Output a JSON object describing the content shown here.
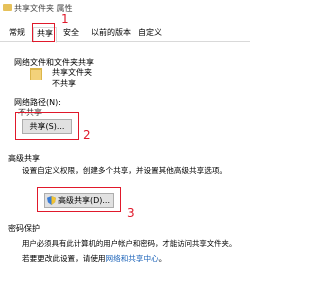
{
  "window": {
    "title": "共享文件夹 属性"
  },
  "tabs": [
    {
      "label": "常规"
    },
    {
      "label": "共享"
    },
    {
      "label": "安全"
    },
    {
      "label": "以前的版本"
    },
    {
      "label": "自定义"
    }
  ],
  "network_share": {
    "section_title": "网络文件和文件夹共享",
    "folder_name": "共享文件夹",
    "status": "不共享",
    "path_label": "网络路径(N):",
    "path_value": "不共享",
    "share_button": "共享(S)..."
  },
  "advanced": {
    "section_title": "高级共享",
    "description": "设置自定义权限，创建多个共享，并设置其他高级共享选项。",
    "button": "高级共享(D)..."
  },
  "password": {
    "section_title": "密码保护",
    "line1": "用户必须具有此计算机的用户帐户和密码，才能访问共享文件夹。",
    "line2_prefix": "若要更改此设置，请使用",
    "link": "网络和共享中心",
    "line2_suffix": "。"
  },
  "annotations": {
    "n1": "1",
    "n2": "2",
    "n3": "3"
  },
  "colors": {
    "annotation": "#e0192b",
    "link": "#1a62b8"
  }
}
